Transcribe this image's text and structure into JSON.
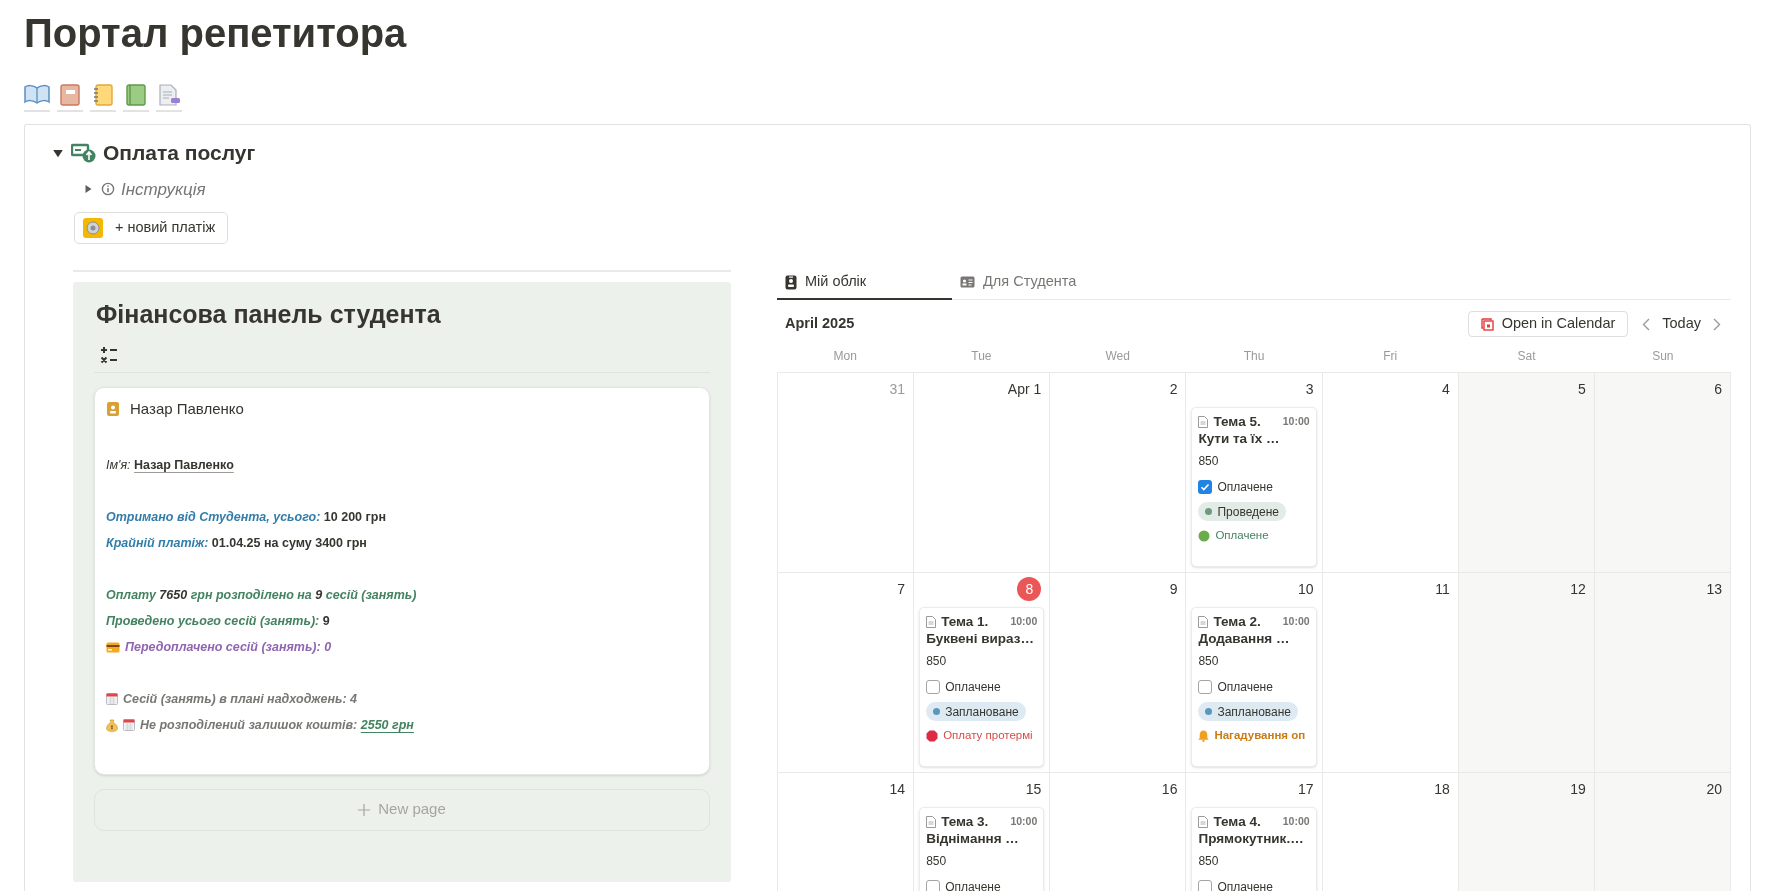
{
  "page": {
    "title": "Портал репетитора"
  },
  "toggle": {
    "title": "Оплата послуг",
    "expanded": true,
    "instruction": {
      "label": "Інструкція",
      "expanded": false
    },
    "new_payment_button": "+ новий платіж"
  },
  "finance_panel": {
    "title": "Фінансова панель студента",
    "card": {
      "name": "Назар Павленко",
      "sections": [
        [
          {
            "kind": "plain",
            "segments": [
              {
                "text": "Ім'я:",
                "kind": "label"
              },
              {
                "text": "Назар Павленко",
                "kind": "name"
              }
            ]
          }
        ],
        [
          {
            "kind": "plain",
            "segments": [
              {
                "text": "Отримано від Студента, усього:",
                "kind": "blue"
              },
              {
                "text": "10 200 грн",
                "kind": "value"
              }
            ]
          },
          {
            "kind": "plain",
            "segments": [
              {
                "text": "Крайній платіж:",
                "kind": "blue"
              },
              {
                "text": "01.04.25 на суму 3400 грн",
                "kind": "value"
              }
            ]
          }
        ],
        [
          {
            "kind": "plain",
            "segments": [
              {
                "text": "Оплату",
                "kind": "green"
              },
              {
                "text": "7650",
                "kind": "green-value"
              },
              {
                "text": "грн розподілено на",
                "kind": "green"
              },
              {
                "text": "9",
                "kind": "green-value"
              },
              {
                "text": "сесій (занять)",
                "kind": "green"
              }
            ]
          },
          {
            "kind": "plain",
            "segments": [
              {
                "text": "Проведено усього сесій (занять):",
                "kind": "green"
              },
              {
                "text": "9",
                "kind": "value"
              }
            ]
          },
          {
            "kind": "prepaid",
            "segments": [
              {
                "text": "Передоплачено сесій (занять): 0",
                "kind": "purple"
              }
            ]
          }
        ],
        [
          {
            "kind": "planned",
            "segments": [
              {
                "text": "Сесій (занять) в плані надходжень: 4",
                "kind": "gray"
              }
            ]
          },
          {
            "kind": "balance",
            "segments": [
              {
                "text": "Не розподілений залишок коштів:",
                "kind": "gray"
              },
              {
                "text": "2550 грн",
                "kind": "green-link"
              }
            ]
          }
        ]
      ]
    },
    "new_page_button": "New page"
  },
  "tabs": [
    {
      "label": "Мій облік",
      "selected": true
    },
    {
      "label": "Для Студента",
      "selected": false
    }
  ],
  "calendar": {
    "month": "April 2025",
    "open_button": "Open in Calendar",
    "today_button": "Today",
    "weekdays": [
      "Mon",
      "Tue",
      "Wed",
      "Thu",
      "Fri",
      "Sat",
      "Sun"
    ],
    "weeks": [
      [
        {
          "day": "31",
          "muted": true,
          "today": false
        },
        {
          "day": "Apr 1",
          "muted": false,
          "today": false
        },
        {
          "day": "2",
          "muted": false,
          "today": false
        },
        {
          "day": "3",
          "muted": false,
          "today": false,
          "events": [
            {
              "number": "Тема 5.",
              "title": "Кути та їх …",
              "time": "10:00",
              "price": "850",
              "paid_label": "Оплачене",
              "paid": true,
              "status": {
                "label": "Проведене",
                "color": "#6c9b7d"
              },
              "note": {
                "kind": "paid",
                "label": "Оплачене"
              }
            }
          ]
        },
        {
          "day": "4",
          "muted": false,
          "today": false
        },
        {
          "day": "5",
          "muted": false,
          "today": false
        },
        {
          "day": "6",
          "muted": false,
          "today": false
        }
      ],
      [
        {
          "day": "7",
          "muted": false,
          "today": false
        },
        {
          "day": "8",
          "muted": false,
          "today": true,
          "events": [
            {
              "number": "Тема 1.",
              "title": "Буквені вираз…",
              "time": "10:00",
              "price": "850",
              "paid_label": "Оплачене",
              "paid": false,
              "status": {
                "label": "Заплановане",
                "color": "#5b97bd"
              },
              "note": {
                "kind": "overdue",
                "label": "Оплату протермі"
              }
            }
          ]
        },
        {
          "day": "9",
          "muted": false,
          "today": false
        },
        {
          "day": "10",
          "muted": false,
          "today": false,
          "events": [
            {
              "number": "Тема 2.",
              "title": "Додавання …",
              "time": "10:00",
              "price": "850",
              "paid_label": "Оплачене",
              "paid": false,
              "status": {
                "label": "Заплановане",
                "color": "#5b97bd"
              },
              "note": {
                "kind": "reminder",
                "label": "Нагадування оп"
              }
            }
          ]
        },
        {
          "day": "11",
          "muted": false,
          "today": false
        },
        {
          "day": "12",
          "muted": false,
          "today": false
        },
        {
          "day": "13",
          "muted": false,
          "today": false
        }
      ],
      [
        {
          "day": "14",
          "muted": false,
          "today": false
        },
        {
          "day": "15",
          "muted": false,
          "today": false,
          "events": [
            {
              "number": "Тема 3.",
              "title": "Віднімання …",
              "time": "10:00",
              "price": "850",
              "paid_label": "Оплачене",
              "paid": false
            }
          ]
        },
        {
          "day": "16",
          "muted": false,
          "today": false
        },
        {
          "day": "17",
          "muted": false,
          "today": false,
          "events": [
            {
              "number": "Тема 4.",
              "title": "Прямокутник.…",
              "time": "10:00",
              "price": "850",
              "paid_label": "Оплачене",
              "paid": false
            }
          ]
        },
        {
          "day": "18",
          "muted": false,
          "today": false
        },
        {
          "day": "19",
          "muted": false,
          "today": false
        },
        {
          "day": "20",
          "muted": false,
          "today": false
        }
      ]
    ]
  }
}
